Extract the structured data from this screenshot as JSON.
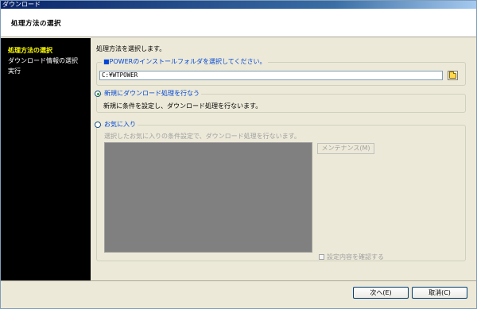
{
  "window": {
    "title": "ダウンロード"
  },
  "header": {
    "title": "処理方法の選択"
  },
  "sidebar": {
    "items": [
      {
        "label": "処理方法の選択",
        "active": true
      },
      {
        "label": "ダウンロード情報の選択",
        "active": false
      },
      {
        "label": "実行",
        "active": false
      }
    ]
  },
  "main": {
    "instruction": "処理方法を選択します。",
    "folder_group": {
      "legend": "■POWERのインストールフォルダを選択してください。",
      "path_value": "C:¥WTPOWER",
      "browse_icon": "folder-icon"
    },
    "new_download": {
      "label": "新規にダウンロード処理を行なう",
      "selected": true,
      "description": "新規に条件を設定し、ダウンロード処理を行ないます。"
    },
    "favorites": {
      "label": "お気に入り",
      "selected": false,
      "description": "選択したお気に入りの条件設定で、ダウンロード処理を行ないます。",
      "maintenance_button": "メンテナンス(M)",
      "confirm_checkbox_label": "設定内容を確認する",
      "confirm_checked": false
    }
  },
  "footer": {
    "next_button": "次へ(E)",
    "cancel_button": "取消(C)"
  },
  "colors": {
    "title_bar": "#0a246a",
    "sidebar_bg": "#000000",
    "sidebar_active": "#ffff00",
    "group_label": "#0046d5"
  }
}
